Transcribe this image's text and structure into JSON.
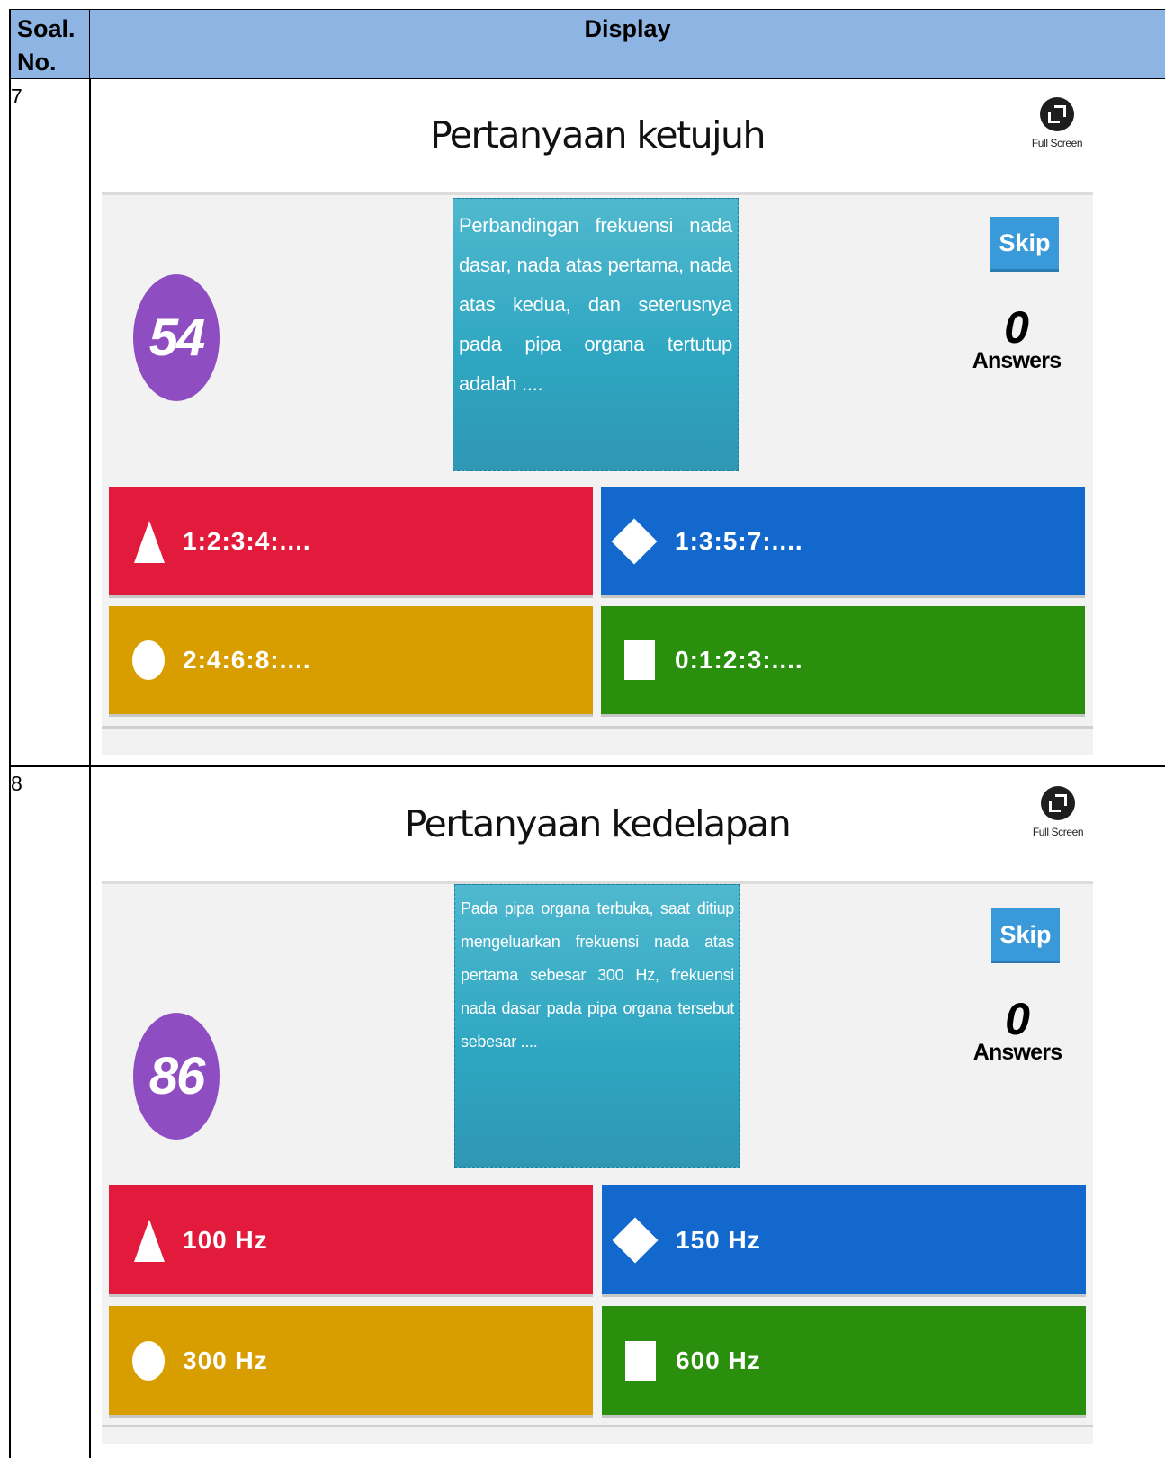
{
  "table": {
    "header_col1": "Soal. No.",
    "header_col2": "Display"
  },
  "rows": [
    {
      "number": "7",
      "title": "Pertanyaan ketujuh",
      "fullscreen_label": "Full Screen",
      "timer": "54",
      "question": "Perbandingan frekuensi nada dasar, nada atas pertama, nada atas kedua, dan seterusnya pada pipa organa tertutup adalah ....",
      "skip_label": "Skip",
      "answers_count": "0",
      "answers_label": "Answers",
      "options": [
        {
          "shape": "triangle",
          "color": "#e21b3c",
          "text": "1:2:3:4:...."
        },
        {
          "shape": "diamond",
          "color": "#1368ce",
          "text": "1:3:5:7:...."
        },
        {
          "shape": "circle",
          "color": "#d89e00",
          "text": "2:4:6:8:...."
        },
        {
          "shape": "square",
          "color": "#298f0d",
          "text": "0:1:2:3:...."
        }
      ]
    },
    {
      "number": "8",
      "title": "Pertanyaan kedelapan",
      "fullscreen_label": "Full Screen",
      "timer": "86",
      "question": "Pada pipa organa terbuka, saat ditiup mengeluarkan frekuensi nada atas pertama sebesar 300 Hz, frekuensi nada dasar pada pipa organa tersebut sebesar ....",
      "skip_label": "Skip",
      "answers_count": "0",
      "answers_label": "Answers",
      "options": [
        {
          "shape": "triangle",
          "color": "#e21b3c",
          "text": "100 Hz"
        },
        {
          "shape": "diamond",
          "color": "#1368ce",
          "text": "150 Hz"
        },
        {
          "shape": "circle",
          "color": "#d89e00",
          "text": "300 Hz"
        },
        {
          "shape": "square",
          "color": "#298f0d",
          "text": "600 Hz"
        }
      ]
    }
  ]
}
